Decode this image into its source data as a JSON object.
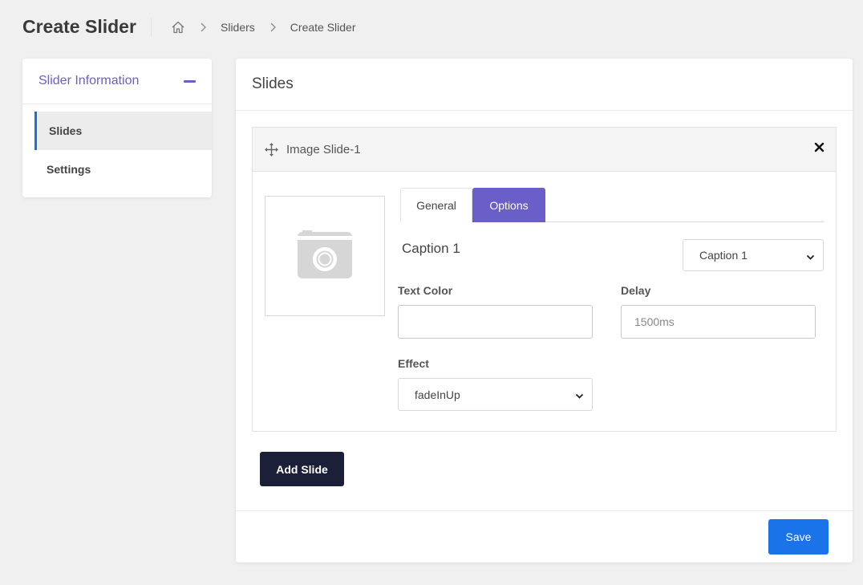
{
  "header": {
    "page_title": "Create Slider",
    "breadcrumb": [
      "Sliders",
      "Create Slider"
    ]
  },
  "sidebar": {
    "title": "Slider Information",
    "items": [
      {
        "label": "Slides",
        "active": true
      },
      {
        "label": "Settings",
        "active": false
      }
    ]
  },
  "main": {
    "title": "Slides",
    "slide": {
      "title": "Image Slide-1",
      "tabs": [
        {
          "label": "General",
          "active": false
        },
        {
          "label": "Options",
          "active": true
        }
      ],
      "caption_title": "Caption 1",
      "caption_select": "Caption 1",
      "text_color_label": "Text Color",
      "text_color_value": "",
      "delay_label": "Delay",
      "delay_placeholder": "1500ms",
      "effect_label": "Effect",
      "effect_value": "fadeInUp"
    },
    "add_slide_label": "Add Slide",
    "save_label": "Save"
  },
  "colors": {
    "accent": "#6a5fc9",
    "primary": "#1a73e8",
    "dark_button": "#1b2038",
    "active_nav_border": "#1c6ee0"
  },
  "icons": [
    "home-icon",
    "chevron-right-icon",
    "minus-icon",
    "move-icon",
    "close-icon",
    "camera-icon",
    "chevron-down-icon"
  ]
}
